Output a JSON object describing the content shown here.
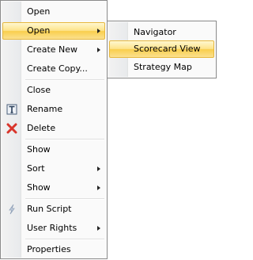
{
  "menu": {
    "items": [
      {
        "label": "Open"
      },
      {
        "label": "Open"
      },
      {
        "label": "Create New"
      },
      {
        "label": "Create Copy..."
      },
      {
        "label": "Close"
      },
      {
        "label": "Rename"
      },
      {
        "label": "Delete"
      },
      {
        "label": "Show"
      },
      {
        "label": "Sort"
      },
      {
        "label": "Show"
      },
      {
        "label": "Run Script"
      },
      {
        "label": "User Rights"
      },
      {
        "label": "Properties"
      }
    ]
  },
  "submenu": {
    "items": [
      {
        "label": "Navigator"
      },
      {
        "label": "Scorecard View"
      },
      {
        "label": "Strategy Map"
      }
    ]
  },
  "icons": {
    "rename": "rename-icon",
    "delete": "delete-x-icon",
    "run_script": "lightning-script-icon"
  },
  "colors": {
    "highlight_top": "#fff7d0",
    "highlight_bottom": "#f9ce4d",
    "highlight_border": "#e6b83f",
    "delete_icon": "#d9352b"
  }
}
